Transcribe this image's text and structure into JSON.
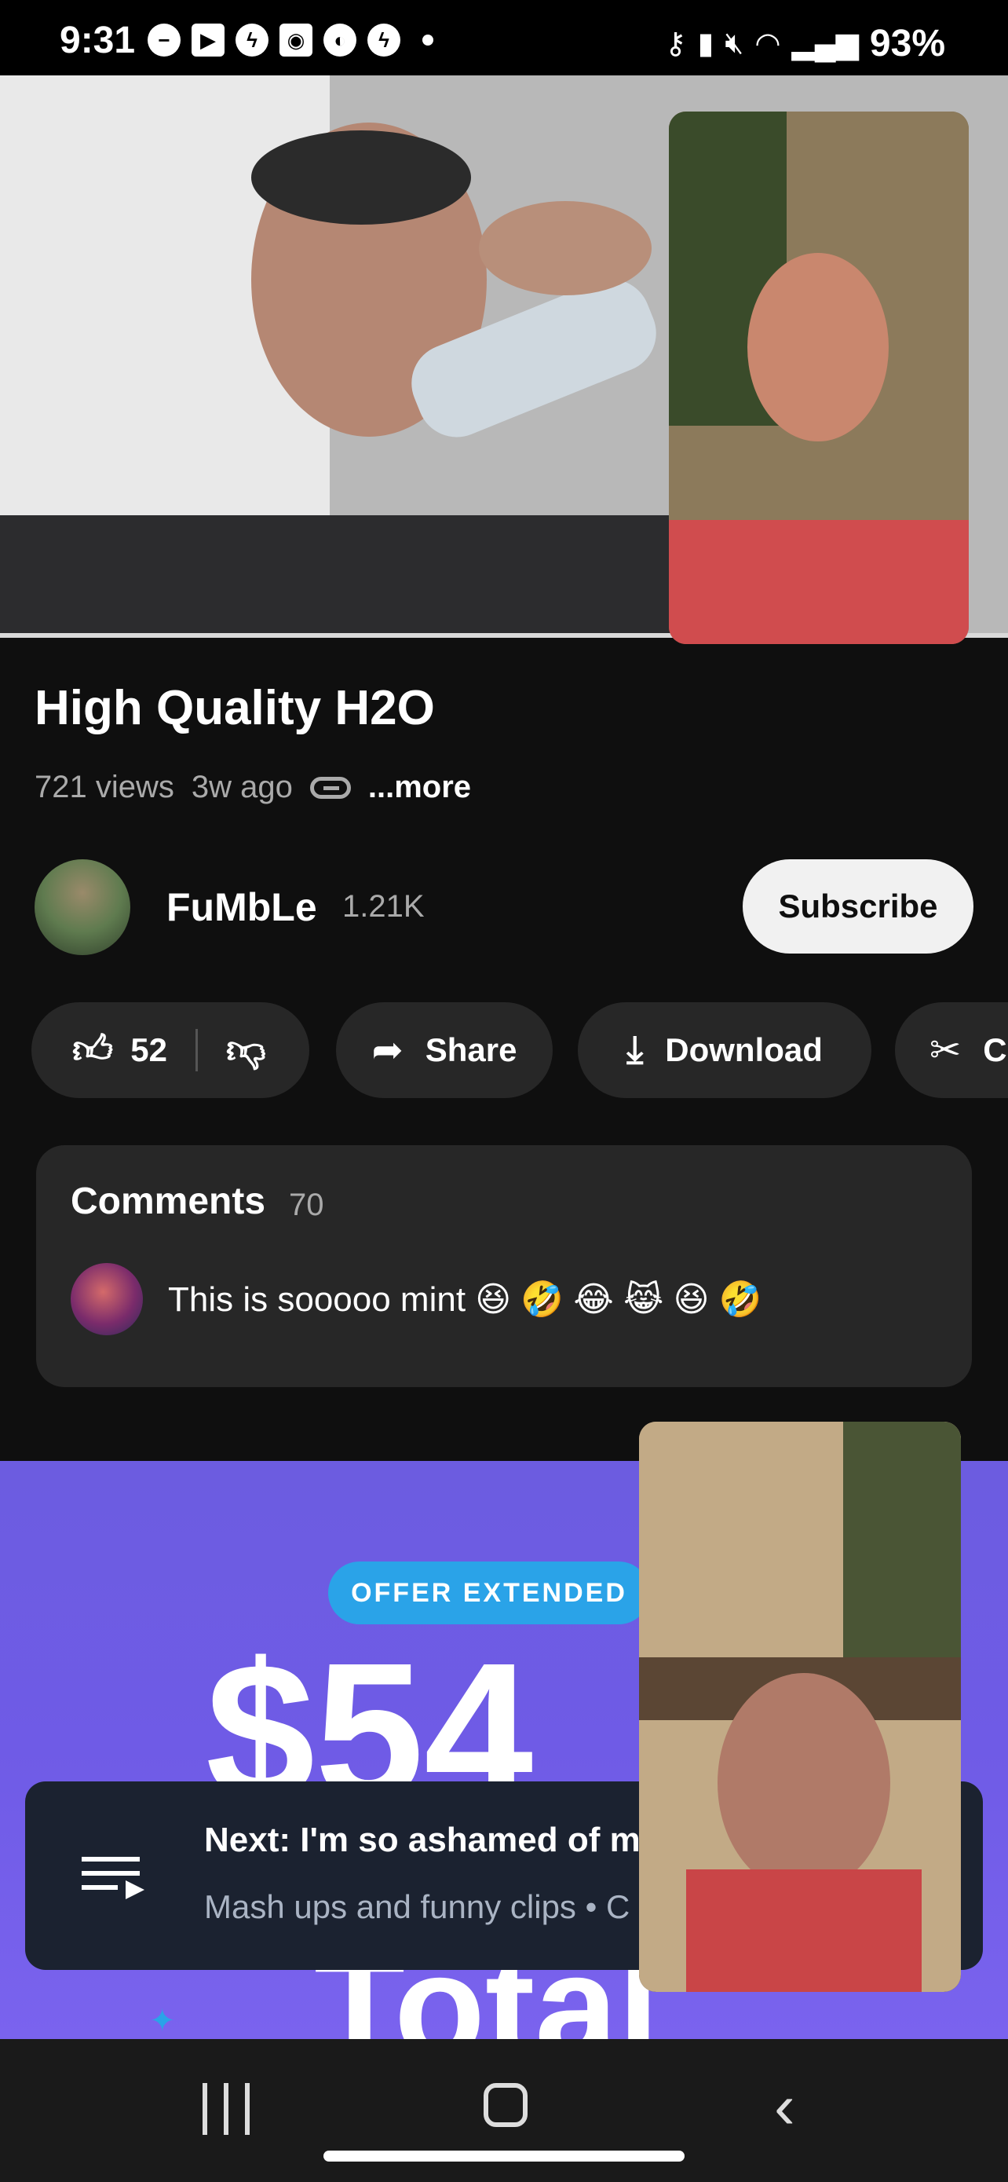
{
  "status_bar": {
    "time": "9:31",
    "battery": "93%",
    "left_icons": [
      "do-not-disturb-icon",
      "video-call-icon",
      "messenger-icon",
      "app-icon",
      "sync-icon",
      "messenger-icon",
      "dot-icon"
    ],
    "right_icons": [
      "key-icon",
      "battery-saver-icon",
      "mute-icon",
      "wifi-icon",
      "signal-icon",
      "battery-icon"
    ]
  },
  "video": {
    "title": "High Quality H2O",
    "views": "721 views",
    "age": "3w ago",
    "more_label": "...more"
  },
  "channel": {
    "name": "FuMbLe",
    "subscribers": "1.21K",
    "subscribe_label": "Subscribe"
  },
  "actions": {
    "likes": "52",
    "share_label": "Share",
    "download_label": "Download",
    "clip_label": "C"
  },
  "comments": {
    "title": "Comments",
    "count": "70",
    "top_comment": "This is sooooo mint 😆 🤣 😂 😹 😆 🤣"
  },
  "ad": {
    "badge": "OFFER EXTENDED",
    "price": "$54",
    "total": "Total"
  },
  "next_up": {
    "title": "Next: I'm so ashamed of my",
    "subtitle": "Mash ups and funny clips • C"
  },
  "colors": {
    "background": "#0f0f0f",
    "surface": "#272727",
    "ad_purple": "#6c5ce0",
    "ad_blue": "#2aa3e8"
  }
}
